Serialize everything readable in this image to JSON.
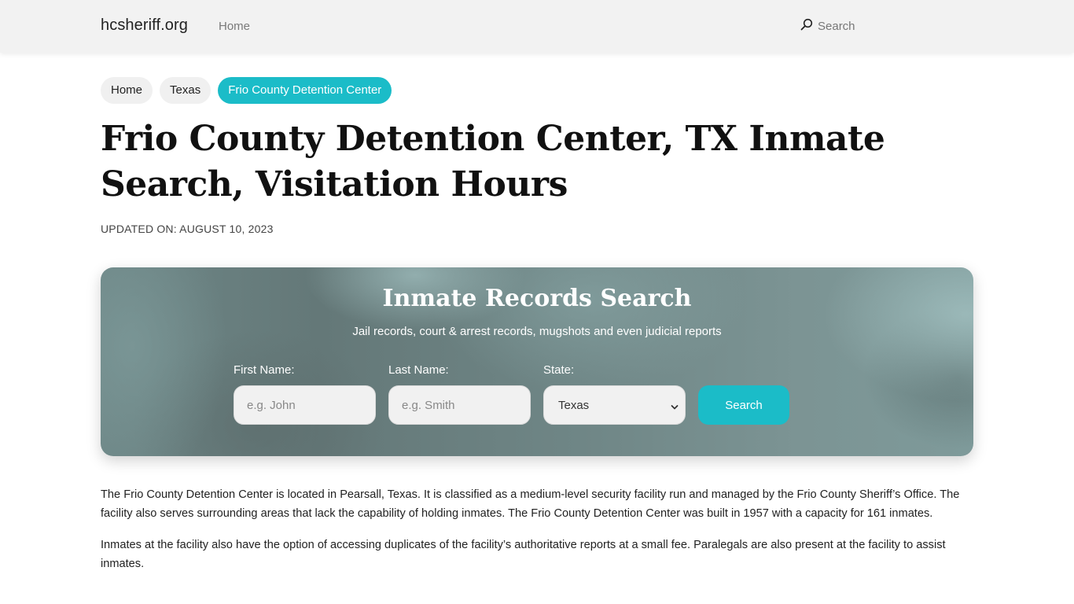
{
  "header": {
    "brand": "hcsheriff.org",
    "nav_home": "Home",
    "search_label": "Search",
    "search_icon": "search-icon"
  },
  "breadcrumb": {
    "items": [
      {
        "label": "Home",
        "active": false
      },
      {
        "label": "Texas",
        "active": false
      },
      {
        "label": "Frio County Detention Center",
        "active": true
      }
    ]
  },
  "page": {
    "title": "Frio County Detention Center, TX Inmate Search, Visitation Hours",
    "updated": "UPDATED ON: AUGUST 10, 2023"
  },
  "search_panel": {
    "title": "Inmate Records Search",
    "subtitle": "Jail records, court & arrest records, mugshots and even judicial reports",
    "first_name": {
      "label": "First Name:",
      "placeholder": "e.g. John",
      "value": ""
    },
    "last_name": {
      "label": "Last Name:",
      "placeholder": "e.g. Smith",
      "value": ""
    },
    "state": {
      "label": "State:",
      "selected": "Texas"
    },
    "button_label": "Search"
  },
  "content": {
    "paragraphs": [
      "The Frio County Detention Center is located in Pearsall, Texas. It is classified as a medium-level security facility run and managed by the Frio County Sheriff’s Office. The facility also serves surrounding areas that lack the capability of holding inmates. The Frio County Detention Center was built in 1957 with a capacity for 161 inmates.",
      "Inmates at the facility also have the option of accessing duplicates of the facility’s authoritative reports at a small fee. Paralegals are also present at the facility to assist inmates."
    ]
  },
  "colors": {
    "accent": "#1bbcc8",
    "navbar_bg": "#f2f2f2",
    "panel_base": "#6e8787"
  }
}
